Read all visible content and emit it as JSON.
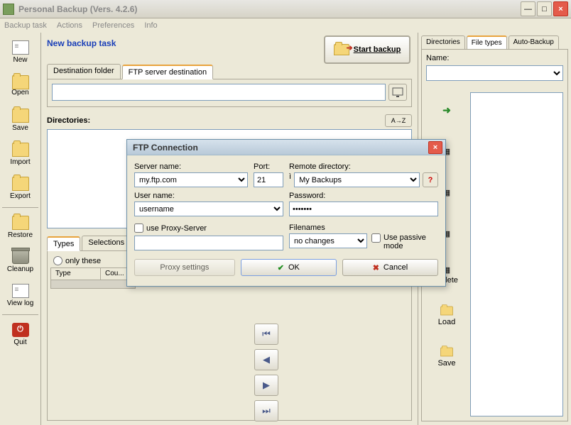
{
  "title": "Personal Backup (Vers. 4.2.6)",
  "menubar": [
    "Backup task",
    "Actions",
    "Preferences",
    "Info"
  ],
  "lefttool": {
    "items": [
      "New",
      "Open",
      "Save",
      "Import",
      "Export",
      "Restore",
      "Cleanup",
      "View log",
      "Quit"
    ]
  },
  "center": {
    "taskname": "New backup task",
    "startbackup": "Start backup",
    "tabs1": [
      "Destination folder",
      "FTP server destination"
    ],
    "tabs1_active": 1,
    "directories_label": "Directories:",
    "az_label": "A→Z",
    "tabs2": [
      "Types",
      "Selections"
    ],
    "tabs2_active": 0,
    "only_these": "only these",
    "table_cols": [
      "Type",
      "Cou..."
    ]
  },
  "rightbar": {
    "tabs": [
      "Directories",
      "File types",
      "Auto-Backup"
    ],
    "active": 1,
    "name_label": "Name:",
    "btns": [
      "",
      "",
      "",
      "",
      "Delete",
      "Load",
      "Save"
    ]
  },
  "modal": {
    "title": "FTP Connection",
    "server_label": "Server name:",
    "server_value": "my.ftp.com",
    "port_label": "Port:",
    "port_value": "21",
    "remote_label": "Remote directory:",
    "remote_value": "My Backups",
    "user_label": "User name:",
    "user_value": "username",
    "pass_label": "Password:",
    "pass_value": "•••••••",
    "proxy_check": "use Proxy-Server",
    "filenames_label": "Filenames",
    "filenames_value": "no changes",
    "passive_label": "Use passive mode",
    "proxy_settings": "Proxy settings",
    "ok": "OK",
    "cancel": "Cancel",
    "help": "?"
  }
}
